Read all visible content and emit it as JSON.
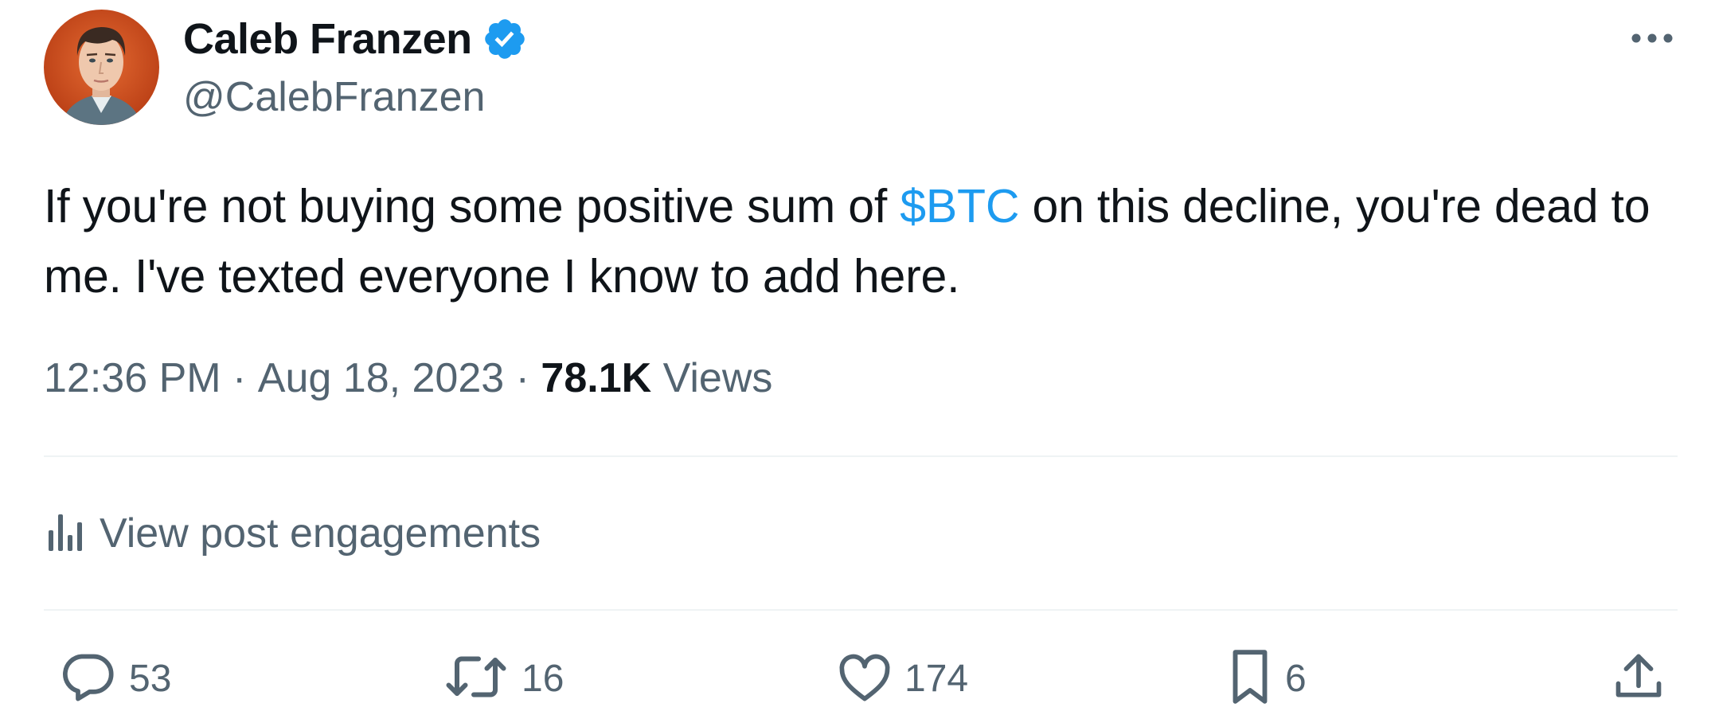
{
  "author": {
    "name": "Caleb Franzen",
    "handle": "@CalebFranzen",
    "verified_icon": "verified-badge-icon",
    "avatar_icon": "avatar"
  },
  "tweet": {
    "text_before": "If you're not buying some positive sum of ",
    "cashtag": "$BTC",
    "text_after": " on this decline, you're dead to me. I've texted everyone I know to add here."
  },
  "meta": {
    "time": "12:36 PM",
    "separator": " · ",
    "date": "Aug 18, 2023",
    "views_count": "78.1K",
    "views_label": " Views"
  },
  "engagements": {
    "label": "View post engagements",
    "icon": "bar-chart-icon"
  },
  "actions": {
    "replies": "53",
    "retweets": "16",
    "likes": "174",
    "bookmarks": "6"
  },
  "colors": {
    "accent": "#1d9bf0",
    "text": "#0f1419",
    "secondary": "#536471",
    "divider": "#eff3f4"
  }
}
